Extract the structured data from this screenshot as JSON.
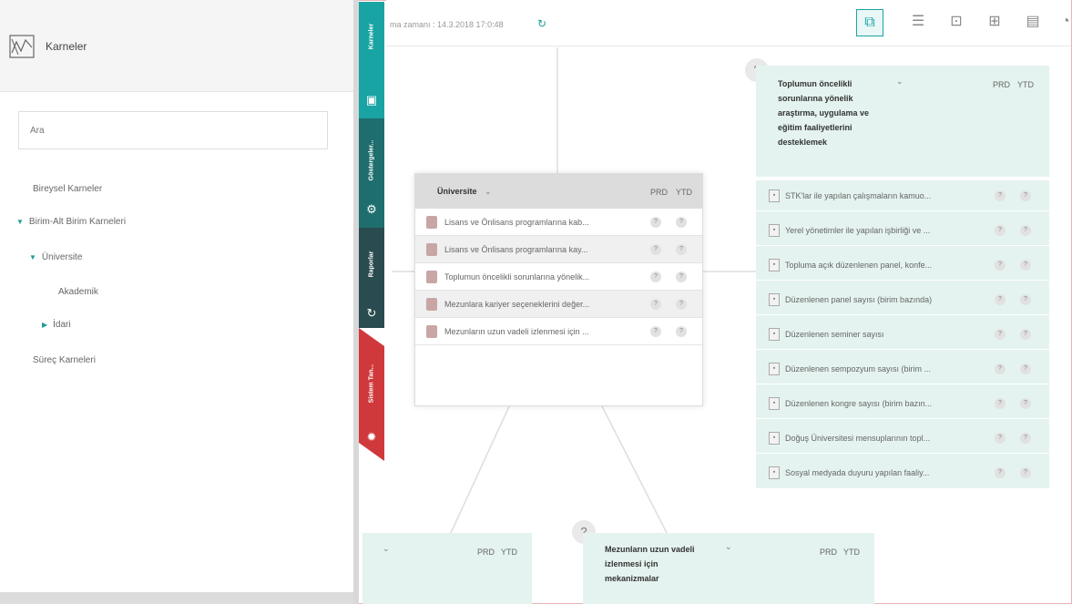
{
  "sidebar": {
    "title": "Karneler",
    "search_placeholder": "Ara",
    "items": [
      {
        "label": "Bireysel Karneler"
      },
      {
        "label": "Birim-Alt Birim Karneleri"
      },
      {
        "label": "Üniversite"
      },
      {
        "label": "Akademik"
      },
      {
        "label": "İdari"
      },
      {
        "label": "Süreç Karneleri"
      }
    ]
  },
  "vtabs": [
    {
      "label": "Karneler",
      "color": "#1aa3a3"
    },
    {
      "label": "Göstergeler...",
      "color": "#1f6e6e"
    },
    {
      "label": "Raporlar",
      "color": "#2a4b4f"
    },
    {
      "label": "Sistem Tan...",
      "color": "#d0393b"
    }
  ],
  "topbar": {
    "last_update": "ma zamanı : 14.3.2018 17:0:48",
    "icons": [
      "org-chart-icon",
      "list-icon",
      "add-window-icon",
      "add-column-icon",
      "calendar-icon",
      "gauge-icon"
    ]
  },
  "col_prd": "PRD",
  "col_ytd": "YTD",
  "badge": "?",
  "help": "?",
  "center_box": {
    "title": "Üniversite",
    "rows": [
      "Lisans ve Önlisans programlarına kab...",
      "Lisans ve Önlisans programlarına kay...",
      "Toplumun öncelikli sorunlarına yönelik...",
      "Mezunlara kariyer seçeneklerini değer...",
      "Mezunların uzun vadeli izlenmesi için ..."
    ]
  },
  "right_box": {
    "title_lines": [
      "Toplumun öncelikli",
      "sorunlarına yönelik",
      "araştırma, uygulama ve",
      "eğitim faaliyetlerini",
      "desteklemek"
    ],
    "rows": [
      "STK'lar ile yapılan çalışmaların kamuo...",
      "Yerel yönetimler ile yapılan işbirliği ve ...",
      "Topluma açık düzenlenen panel, konfe...",
      "Düzenlenen panel sayısı (birim bazında)",
      "Düzenlenen seminer sayısı",
      "Düzenlenen sempozyum sayısı (birim ...",
      "Düzenlenen kongre sayısı (birim bazın...",
      "Doğuş Üniversitesi mensuplarının topl...",
      "Sosyal medyada duyuru yapılan faaliy..."
    ]
  },
  "bottom_box": {
    "title_lines": [
      "Mezunların uzun vadeli",
      "izlenmesi için",
      "mekanizmalar"
    ]
  },
  "colors": {
    "teal": "#1aa3a3",
    "accent_red": "#d0393b"
  }
}
